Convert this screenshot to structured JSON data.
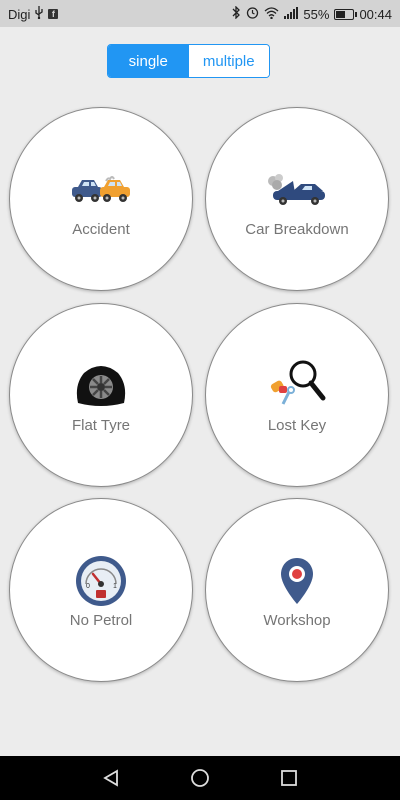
{
  "status_bar": {
    "carrier": "Digi",
    "battery_percent": "55%",
    "battery_level": 0.55,
    "time": "00:44",
    "icons": [
      "usb-icon",
      "facebook-icon",
      "bluetooth-icon",
      "alarm-icon",
      "wifi-icon",
      "signal-icon",
      "battery-icon"
    ]
  },
  "mode_toggle": {
    "options": [
      "single",
      "multiple"
    ],
    "selected": "single",
    "accent_color": "#2196f3"
  },
  "services": [
    {
      "label": "Accident",
      "icon": "car-crash-icon"
    },
    {
      "label": "Car Breakdown",
      "icon": "car-breakdown-icon"
    },
    {
      "label": "Flat Tyre",
      "icon": "flat-tyre-icon"
    },
    {
      "label": "Lost Key",
      "icon": "lost-key-icon"
    },
    {
      "label": "No Petrol",
      "icon": "fuel-gauge-icon"
    },
    {
      "label": "Workshop",
      "icon": "location-pin-icon"
    }
  ],
  "nav_bar": {
    "buttons": [
      "back-icon",
      "home-icon",
      "recents-icon"
    ]
  }
}
